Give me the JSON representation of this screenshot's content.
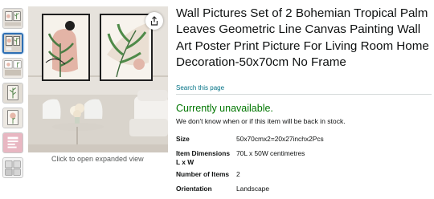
{
  "product": {
    "title": "Wall Pictures Set of 2 Bohemian Tropical Palm Leaves Geometric Line Canvas Painting Wall Art Poster Print Picture For Living Room Home Decoration-50x70cm No Frame",
    "search_link": "Search this page",
    "availability": "Currently unavailable.",
    "availability_note": "We don't know when or if this item will be back in stock.",
    "expand_hint": "Click to open expanded view"
  },
  "specs": [
    {
      "key": "Size",
      "value": "50x70cmx2=20x27inchx2Pcs"
    },
    {
      "key": "Item Dimensions L x W",
      "value": "70L x 50W centimetres"
    },
    {
      "key": "Number of Items",
      "value": "2"
    },
    {
      "key": "Orientation",
      "value": "Landscape"
    }
  ],
  "icons": {
    "share": "share-icon"
  },
  "colors": {
    "link": "#007185",
    "available": "#007600",
    "active_thumb": "#2f6fb3"
  }
}
